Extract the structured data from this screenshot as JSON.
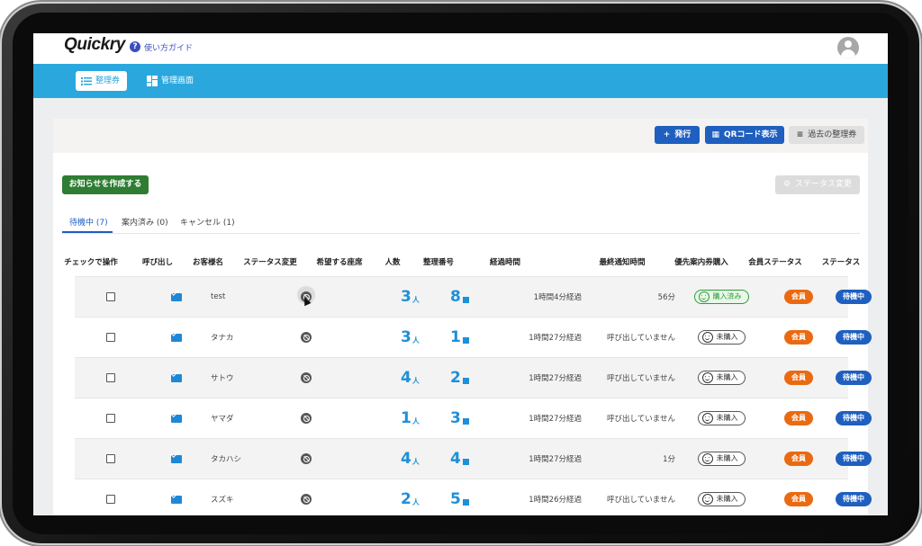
{
  "app": {
    "logo": "Quickry",
    "guide_label": "使い方ガイド"
  },
  "nav": {
    "ticket_label": "整理券",
    "admin_label": "管理画面"
  },
  "toolbar": {
    "issue_label": "発行",
    "qr_label": "QRコード表示",
    "past_label": "過去の整理券",
    "notice_label": "お知らせを作成する",
    "status_change_label": "ステータス変更"
  },
  "tabs": {
    "waiting": "待機中 (7)",
    "guided": "案内済み (0)",
    "cancel": "キャンセル (1)"
  },
  "table": {
    "headers": {
      "check": "チェックで操作",
      "call": "呼び出し",
      "name": "お客様名",
      "status_change": "ステータス変更",
      "seat": "希望する座席",
      "people": "人数",
      "number": "整理番号",
      "elapsed": "経過時間",
      "last_notify": "最終通知時間",
      "priority": "優先案内券購入",
      "member": "会員ステータス",
      "status": "ステータス"
    },
    "people_unit": "人",
    "rows": [
      {
        "name": "test",
        "people": "3",
        "number": "8",
        "elapsed": "1時間4分経過",
        "last_notify": "56分",
        "priority": "購入済み",
        "member": "会員",
        "status": "待機中"
      },
      {
        "name": "タナカ",
        "people": "3",
        "number": "1",
        "elapsed": "1時間27分経過",
        "last_notify": "呼び出していません",
        "priority": "未購入",
        "member": "会員",
        "status": "待機中"
      },
      {
        "name": "サトウ",
        "people": "4",
        "number": "2",
        "elapsed": "1時間27分経過",
        "last_notify": "呼び出していません",
        "priority": "未購入",
        "member": "会員",
        "status": "待機中"
      },
      {
        "name": "ヤマダ",
        "people": "1",
        "number": "3",
        "elapsed": "1時間27分経過",
        "last_notify": "呼び出していません",
        "priority": "未購入",
        "member": "会員",
        "status": "待機中"
      },
      {
        "name": "タカハシ",
        "people": "4",
        "number": "4",
        "elapsed": "1時間27分経過",
        "last_notify": "1分",
        "priority": "未購入",
        "member": "会員",
        "status": "待機中"
      },
      {
        "name": "スズキ",
        "people": "2",
        "number": "5",
        "elapsed": "1時間26分経過",
        "last_notify": "呼び出していません",
        "priority": "未購入",
        "member": "会員",
        "status": "待機中"
      }
    ]
  },
  "colors": {
    "nav_blue": "#2aa8de",
    "primary": "#1f5fbf",
    "green": "#2e7d32",
    "member_orange": "#ea6a12"
  },
  "icons": [
    "help-icon",
    "list-icon",
    "dashboard-icon",
    "plus-icon",
    "qr-icon",
    "gear-icon",
    "mail-icon",
    "ban-icon",
    "smile-icon",
    "avatar-icon"
  ]
}
